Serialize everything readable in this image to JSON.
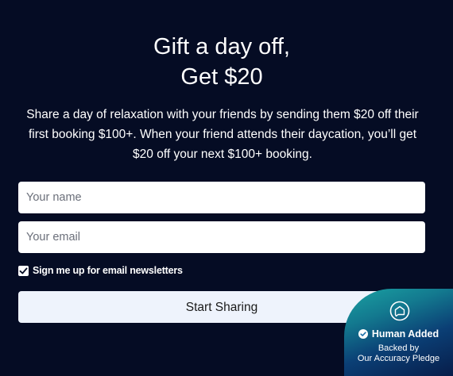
{
  "hero": {
    "title_line1": "Gift a day off,",
    "title_line2": "Get $20",
    "description": "Share a day of relaxation with your friends by sending them $20 off their first booking $100+. When your friend attends their daycation, you’ll get $20 off your next $100+ booking."
  },
  "form": {
    "name_placeholder": "Your name",
    "name_value": "",
    "email_placeholder": "Your email",
    "email_value": "",
    "newsletter_label": "Sign me up for email newsletters",
    "newsletter_checked": true,
    "submit_label": "Start Sharing"
  },
  "badge": {
    "title": "Human Added",
    "subtitle_line1": "Backed by",
    "subtitle_line2": "Our Accuracy Pledge"
  },
  "colors": {
    "background": "#050c24",
    "input_background": "#ffffff",
    "button_background": "#eef3fc",
    "badge_teal": "#1aa3a3",
    "badge_navy": "#071d4a"
  },
  "icons": {
    "checkbox": "check-icon",
    "badge_logo": "house-chat-logo-icon",
    "badge_check": "check-circle-icon"
  }
}
